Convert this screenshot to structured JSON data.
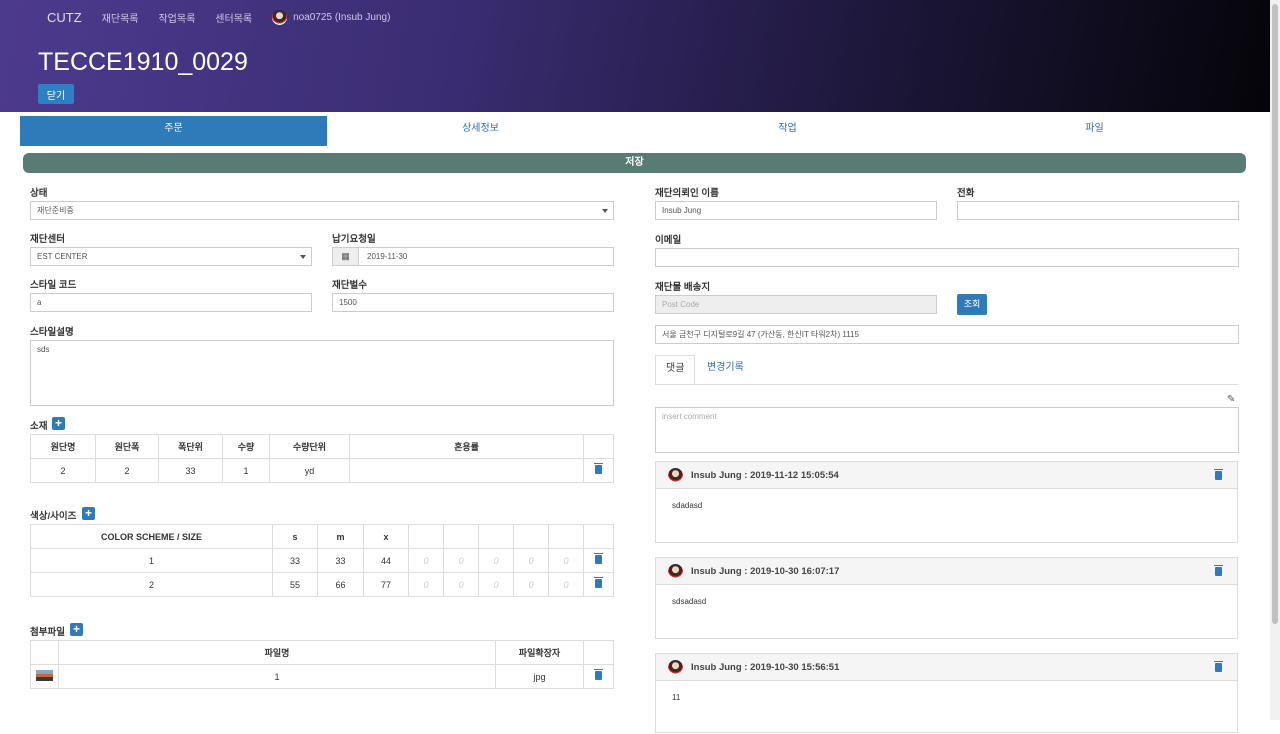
{
  "nav": {
    "brand": "CUTZ",
    "items": [
      "재단목록",
      "작업목록",
      "센터목록"
    ],
    "user": "noa0725 (Insub Jung)"
  },
  "page": {
    "title": "TECCE1910_0029",
    "close_label": "닫기"
  },
  "tabs": [
    "주문",
    "상세정보",
    "작업",
    "파일"
  ],
  "save_label": "저장",
  "form": {
    "status_label": "상태",
    "status_value": "재단준비중",
    "center_label": "재단센터",
    "center_value": "EST CENTER",
    "due_label": "납기요청일",
    "due_value": "2019-11-30",
    "style_code_label": "스타일 코드",
    "style_code_value": "a",
    "cut_count_label": "재단벌수",
    "cut_count_value": "1500",
    "style_desc_label": "스타일설명",
    "style_desc_value": "sds",
    "requester_label": "재단의뢰인 이름",
    "requester_value": "Insub Jung",
    "phone_label": "전화",
    "phone_value": "",
    "email_label": "이메일",
    "email_value": "",
    "ship_label": "재단물 배송지",
    "postcode_placeholder": "Post Code",
    "lookup_label": "조회",
    "address_value": "서울 금천구 디지털로9길 47 (가산동, 한신IT 타워2차) 1115"
  },
  "material": {
    "label": "소재",
    "headers": [
      "원단명",
      "원단폭",
      "폭단위",
      "수량",
      "수량단위",
      "혼용률"
    ],
    "rows": [
      [
        "2",
        "2",
        "33",
        "1",
        "yd",
        ""
      ]
    ]
  },
  "color_size": {
    "label": "색상/사이즈",
    "header": "COLOR SCHEME / SIZE",
    "sizes": [
      "s",
      "m",
      "x"
    ],
    "rows": [
      {
        "name": "1",
        "values": [
          "33",
          "33",
          "44",
          "0",
          "0",
          "0",
          "0",
          "0"
        ]
      },
      {
        "name": "2",
        "values": [
          "55",
          "66",
          "77",
          "0",
          "0",
          "0",
          "0",
          "0"
        ]
      }
    ]
  },
  "attachments": {
    "label": "첨부파일",
    "headers": [
      "파일명",
      "파일확장자"
    ],
    "rows": [
      {
        "name": "1",
        "ext": "jpg"
      }
    ]
  },
  "comments": {
    "tabs": [
      "댓글",
      "변경기록"
    ],
    "placeholder": "insert comment",
    "items": [
      {
        "head": "Insub Jung : 2019-11-12 15:05:54",
        "body": "sdadasd"
      },
      {
        "head": "Insub Jung : 2019-10-30 16:07:17",
        "body": "sdsadasd"
      },
      {
        "head": "Insub Jung : 2019-10-30 15:56:51",
        "body": "11"
      }
    ]
  }
}
